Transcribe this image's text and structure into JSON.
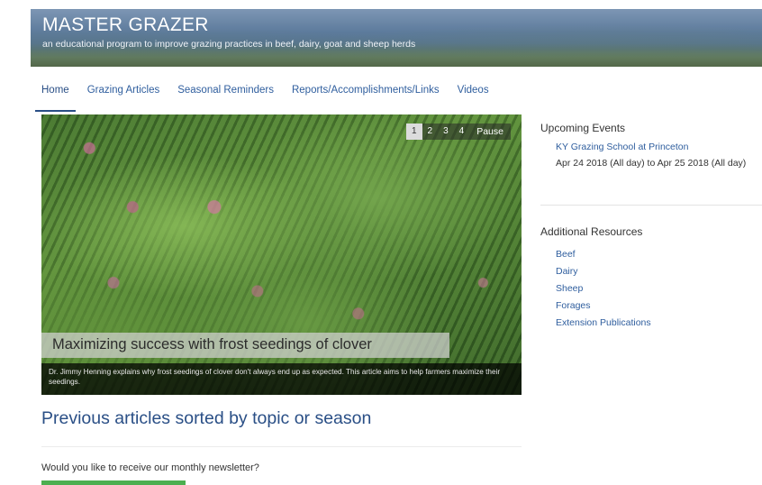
{
  "header": {
    "title": "MASTER GRAZER",
    "tagline": "an educational program to improve grazing practices in beef, dairy, goat and sheep herds"
  },
  "nav": {
    "items": [
      {
        "label": "Home",
        "active": true
      },
      {
        "label": "Grazing Articles"
      },
      {
        "label": "Seasonal Reminders"
      },
      {
        "label": "Reports/Accomplishments/Links"
      },
      {
        "label": "Videos"
      }
    ]
  },
  "slideshow": {
    "pager": [
      "1",
      "2",
      "3",
      "4"
    ],
    "current_page": "1",
    "pause_label": "Pause",
    "title": "Maximizing success with frost seedings of clover",
    "caption": "Dr. Jimmy Henning explains why frost seedings of clover don't always end up as expected. This article aims to help farmers maximize their seedings."
  },
  "main": {
    "section_heading": "Previous articles sorted by topic or season",
    "newsletter_prompt": "Would you like to receive our monthly newsletter?"
  },
  "sidebar": {
    "events_heading": "Upcoming Events",
    "event": {
      "title": "KY Grazing School at Princeton",
      "dates": "Apr 24 2018 (All day) to Apr 25 2018 (All day)"
    },
    "resources_heading": "Additional Resources",
    "resources": [
      "Beef",
      "Dairy",
      "Sheep",
      "Forages",
      "Extension Publications"
    ]
  },
  "colors": {
    "link": "#2f5e9e",
    "heading": "#2a4f86",
    "button": "#4caf50"
  }
}
